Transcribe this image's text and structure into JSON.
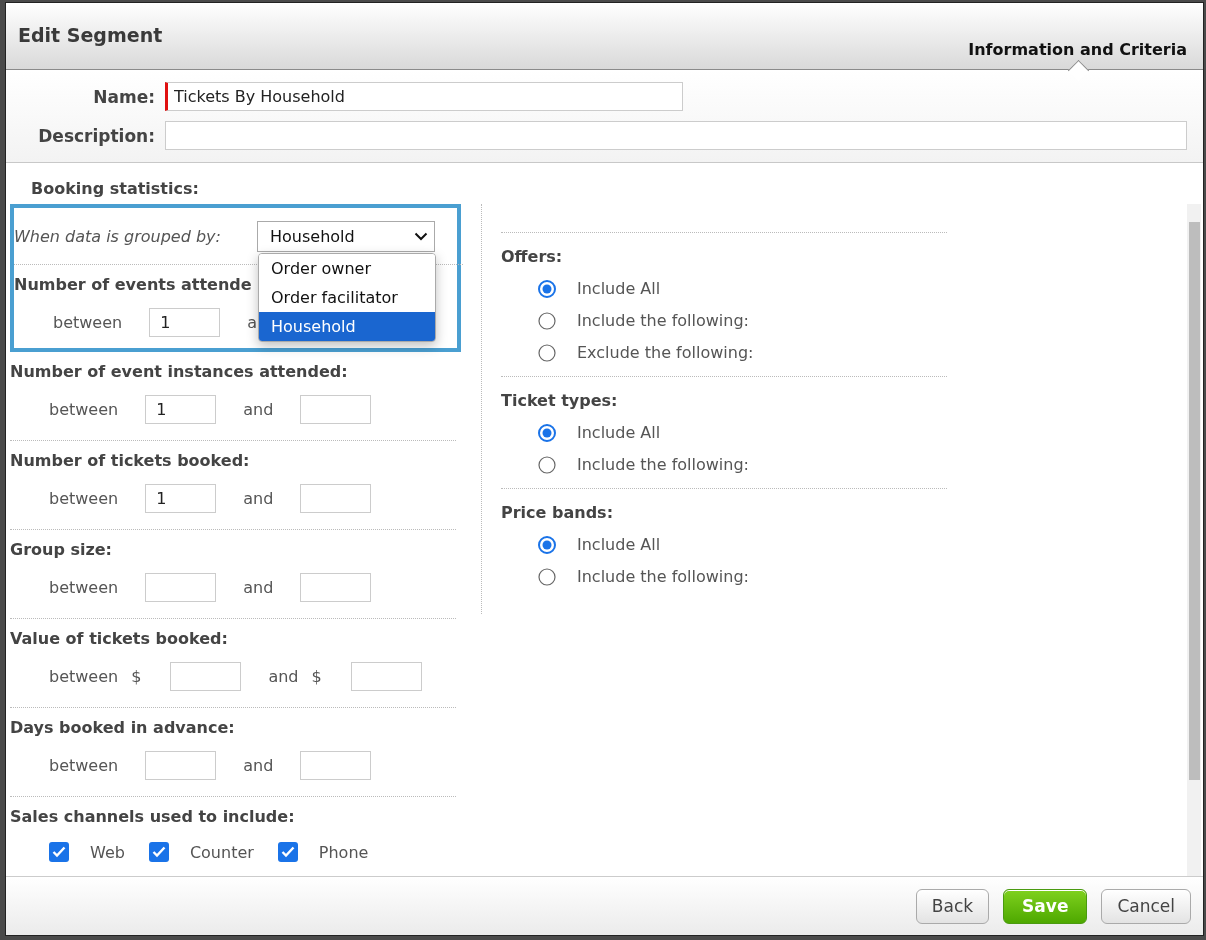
{
  "window": {
    "title": "Edit Segment"
  },
  "tabs": [
    {
      "label": "Information and Criteria",
      "selected": true
    }
  ],
  "fields": [
    {
      "label": "Name:",
      "value": "Tickets By Household",
      "required": true
    },
    {
      "label": "Description:",
      "required": false
    }
  ],
  "booking_statistics": {
    "title": "Booking statistics:",
    "grouped_by": {
      "label": "When data is grouped by:",
      "value": "Household",
      "expanded": true,
      "options": [
        {
          "label": "Order owner",
          "selected": false
        },
        {
          "label": "Order facilitator",
          "selected": false
        },
        {
          "label": "Household",
          "selected": true
        }
      ]
    },
    "ranges": [
      {
        "label": "Number of events attende",
        "from_label": "between",
        "from_value": "1",
        "to_label": "a"
      },
      {
        "label": "Number of event instances attended:",
        "from_label": "between",
        "from_value": "1",
        "to_label": "and"
      },
      {
        "label": "Number of tickets booked:",
        "from_label": "between",
        "from_value": "1",
        "to_label": "and"
      },
      {
        "label": "Group size:",
        "from_label": "between",
        "to_label": "and"
      },
      {
        "label": "Value of tickets booked:",
        "from_label": "between",
        "from_prefix": "$",
        "to_label": "and",
        "to_prefix": "$"
      },
      {
        "label": "Days booked in advance:",
        "from_label": "between",
        "to_label": "and"
      }
    ],
    "sales_channels": {
      "label": "Sales channels used to include:",
      "items": [
        {
          "label": "Web",
          "checked": true
        },
        {
          "label": "Counter",
          "checked": true
        },
        {
          "label": "Phone",
          "checked": true
        }
      ]
    }
  },
  "criteria": [
    {
      "label": "Offers:",
      "options": [
        {
          "label": "Include All",
          "selected": true
        },
        {
          "label": "Include the following:",
          "selected": false
        },
        {
          "label": "Exclude the following:",
          "selected": false
        }
      ]
    },
    {
      "label": "Ticket types:",
      "options": [
        {
          "label": "Include All",
          "selected": true
        },
        {
          "label": "Include the following:",
          "selected": false
        }
      ]
    },
    {
      "label": "Price bands:",
      "options": [
        {
          "label": "Include All",
          "selected": true
        },
        {
          "label": "Include the following:",
          "selected": false
        }
      ]
    }
  ],
  "buttons": [
    {
      "label": "Back",
      "kind": "default"
    },
    {
      "label": "Save",
      "kind": "primary"
    },
    {
      "label": "Cancel",
      "kind": "default"
    }
  ]
}
